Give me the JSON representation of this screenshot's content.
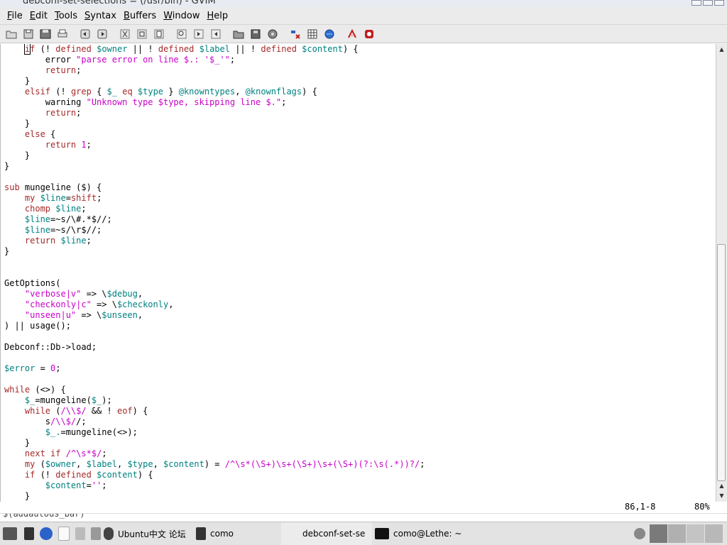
{
  "window": {
    "title": "debconf-set-selections = (/usr/bin) - GVIM"
  },
  "menu": [
    {
      "underline": "F",
      "rest": "ile"
    },
    {
      "underline": "E",
      "rest": "dit"
    },
    {
      "underline": "T",
      "rest": "ools"
    },
    {
      "underline": "S",
      "rest": "yntax"
    },
    {
      "underline": "B",
      "rest": "uffers"
    },
    {
      "underline": "W",
      "rest": "indow"
    },
    {
      "underline": "H",
      "rest": "elp"
    }
  ],
  "toolbar_icons": [
    "open-icon",
    "save-icon",
    "save-all-icon",
    "print-icon",
    "undo-icon",
    "redo-icon",
    "cut-icon",
    "copy-icon",
    "paste-icon",
    "find-icon",
    "find-next-icon",
    "find-prev-icon",
    "load-session-icon",
    "save-session-icon",
    "run-script-icon",
    "make-icon",
    "shell-icon",
    "tags-icon",
    "help-icon",
    "find-help-icon"
  ],
  "code_lines": [
    "    if (! defined $owner || ! defined $label || ! defined $content) {",
    "        error \"parse error on line $.: '$_'\";",
    "        return;",
    "    }",
    "    elsif (! grep { $_ eq $type } @knowntypes, @knownflags) {",
    "        warning \"Unknown type $type, skipping line $.\";",
    "        return;",
    "    }",
    "    else {",
    "        return 1;",
    "    }",
    "}",
    "",
    "sub mungeline ($) {",
    "    my $line=shift;",
    "    chomp $line;",
    "    $line=~s/\\#.*$//;",
    "    $line=~s/\\r$//;",
    "    return $line;",
    "}",
    "",
    "",
    "GetOptions(",
    "    \"verbose|v\" => \\$debug,",
    "    \"checkonly|c\" => \\$checkonly,",
    "    \"unseen|u\" => \\$unseen,",
    ") || usage();",
    "",
    "Debconf::Db->load;",
    "",
    "$error = 0;",
    "",
    "while (<>) {",
    "    $_=mungeline($_);",
    "    while (/\\\\$/ && ! eof) {",
    "        s/\\\\$//;",
    "        $_.=mungeline(<>);",
    "    }",
    "    next if /^\\s*$/;",
    "    my ($owner, $label, $type, $content) = /^\\s*(\\S+)\\s+(\\S+)\\s+(\\S+)(?:\\s(.*))?/;",
    "    if (! defined $content) {",
    "        $content='';",
    "    }"
  ],
  "status": {
    "position": "86,1-8",
    "percent": "80%"
  },
  "terminal_strip": "$(addautous_bar)",
  "taskbar": {
    "task_ubuntu": "Ubuntu中文 论坛",
    "task_como": "como",
    "task_vim": "debconf-set-se",
    "task_term": "como@Lethe: ~"
  },
  "colors": {
    "keyword": "#a52a2a",
    "string": "#c800c8",
    "variable": "#008080",
    "menubar": "#ebebeb"
  }
}
